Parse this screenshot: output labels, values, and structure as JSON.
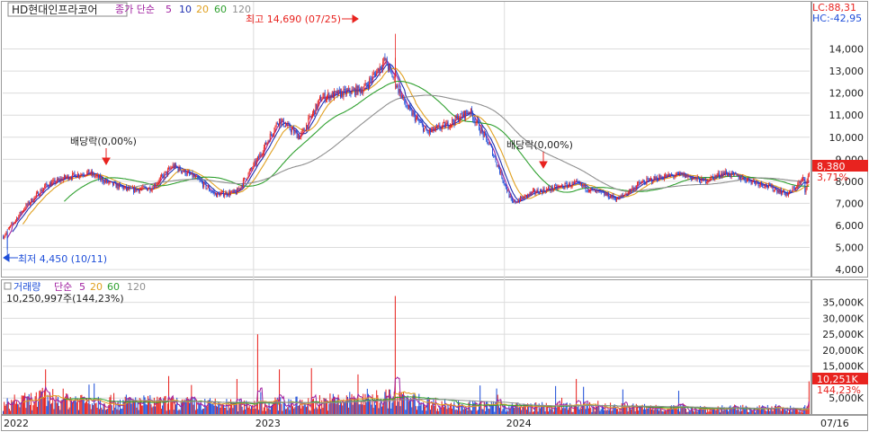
{
  "header": {
    "stock_name": "HD현대인프라코어",
    "legend_label": "종가 단순",
    "ma_periods": [
      "5",
      "10",
      "20",
      "60",
      "120"
    ],
    "lc_label": "LC:88,31",
    "hc_label": "HC:-42,95"
  },
  "volume_header": {
    "label": "거래량",
    "ma_label": "단순",
    "ma_periods": [
      "5",
      "20",
      "60",
      "120"
    ],
    "last_volume": "10,250,997주(144,23%)"
  },
  "colors": {
    "up": "#e8231f",
    "down": "#1f4fd9",
    "ma5": "#a020a0",
    "ma10": "#1f2fb0",
    "ma20": "#e0a020",
    "ma60": "#2fa02f",
    "ma120": "#909090",
    "grid": "#dcdcdc",
    "price_tag_bg": "#e8231f"
  },
  "chart_data": [
    {
      "type": "candlestick",
      "title": "",
      "y_ticks": [
        4000,
        5000,
        6000,
        7000,
        8000,
        9000,
        10000,
        11000,
        12000,
        13000,
        14000
      ],
      "y_tick_labels": [
        "4,000",
        "5,000",
        "6,000",
        "7,000",
        "8,000",
        "9,000",
        "10,000",
        "11,000",
        "12,000",
        "13,000",
        "14,000"
      ],
      "ylim": [
        3800,
        15000
      ],
      "x_labels": [
        "2022",
        "2023",
        "2024",
        "07/16"
      ],
      "grid": true,
      "price_path": [
        {
          "t": "2022-01",
          "close": 5500
        },
        {
          "t": "2022-02",
          "close": 6800
        },
        {
          "t": "2022-03",
          "close": 7800
        },
        {
          "t": "2022-04",
          "close": 8200
        },
        {
          "t": "2022-05",
          "close": 8400
        },
        {
          "t": "2022-06",
          "close": 7900
        },
        {
          "t": "2022-07",
          "close": 7600
        },
        {
          "t": "2022-08",
          "close": 7700
        },
        {
          "t": "2022-09",
          "close": 8700
        },
        {
          "t": "2022-10",
          "close": 8200
        },
        {
          "t": "2022-11",
          "close": 7400
        },
        {
          "t": "2022-12",
          "close": 7500
        },
        {
          "t": "2023-01",
          "close": 9000
        },
        {
          "t": "2023-02",
          "close": 10800
        },
        {
          "t": "2023-03",
          "close": 10000
        },
        {
          "t": "2023-04",
          "close": 11800
        },
        {
          "t": "2023-05",
          "close": 12000
        },
        {
          "t": "2023-06",
          "close": 12200
        },
        {
          "t": "2023-07",
          "close": 13500
        },
        {
          "t": "2023-08",
          "close": 11400
        },
        {
          "t": "2023-09",
          "close": 10200
        },
        {
          "t": "2023-10",
          "close": 10600
        },
        {
          "t": "2023-11",
          "close": 11200
        },
        {
          "t": "2023-12",
          "close": 9500
        },
        {
          "t": "2024-01",
          "close": 7000
        },
        {
          "t": "2024-02",
          "close": 7500
        },
        {
          "t": "2024-03",
          "close": 7700
        },
        {
          "t": "2024-04",
          "close": 7900
        },
        {
          "t": "2024-05",
          "close": 7500
        },
        {
          "t": "2024-06",
          "close": 7200
        },
        {
          "t": "2024-07",
          "close": 7900
        },
        {
          "t": "2024-08",
          "close": 8200
        },
        {
          "t": "2024-09",
          "close": 8300
        },
        {
          "t": "2024-10",
          "close": 8000
        },
        {
          "t": "2024-11",
          "close": 8400
        },
        {
          "t": "2024-12",
          "close": 8100
        },
        {
          "t": "2025-01",
          "close": 7800
        },
        {
          "t": "2025-02",
          "close": 7400
        },
        {
          "t": "2025-03",
          "close": 8380
        }
      ],
      "annotations": {
        "high": "최고 14,690 (07/25)",
        "low": "최저 4,450 (10/11)",
        "dividend_1": "배당락(0,00%)",
        "dividend_2": "배당락(0,00%)"
      },
      "last_price": 8380,
      "last_price_label": "8,380",
      "last_change_label": "3,71%"
    },
    {
      "type": "bar",
      "title": "",
      "y_ticks": [
        5000,
        10000,
        15000,
        20000,
        25000,
        30000,
        35000
      ],
      "y_tick_labels": [
        "5,000K",
        "",
        "15,000K",
        "20,000K",
        "25,000K",
        "30,000K",
        "35,000K"
      ],
      "ylim": [
        0,
        38000
      ],
      "unit": "K",
      "volume_path": [
        {
          "t": "2022-01",
          "avg": 2500
        },
        {
          "t": "2022-03",
          "avg": 4500
        },
        {
          "t": "2022-06",
          "avg": 3500
        },
        {
          "t": "2022-09",
          "avg": 3000
        },
        {
          "t": "2022-12",
          "avg": 2500
        },
        {
          "t": "2023-03",
          "avg": 3000
        },
        {
          "t": "2023-07",
          "avg": 4500
        },
        {
          "t": "2023-10",
          "avg": 2500
        },
        {
          "t": "2024-01",
          "avg": 2000
        },
        {
          "t": "2024-04",
          "avg": 2000
        },
        {
          "t": "2024-07",
          "avg": 1800
        },
        {
          "t": "2024-10",
          "avg": 1600
        },
        {
          "t": "2025-01",
          "avg": 1500
        },
        {
          "t": "2025-03",
          "avg": 1500
        }
      ],
      "spikes": [
        {
          "t": "2023-07",
          "value": 37000
        },
        {
          "t": "2023-01",
          "value": 25000
        },
        {
          "t": "2023-02",
          "value": 14000
        },
        {
          "t": "2024-04",
          "value": 11000
        },
        {
          "t": "2022-03",
          "value": 14000
        },
        {
          "t": "2025-03",
          "value": 10251
        }
      ],
      "last_volume_label": "10,251K",
      "last_volume_pct": "144,23%"
    }
  ]
}
